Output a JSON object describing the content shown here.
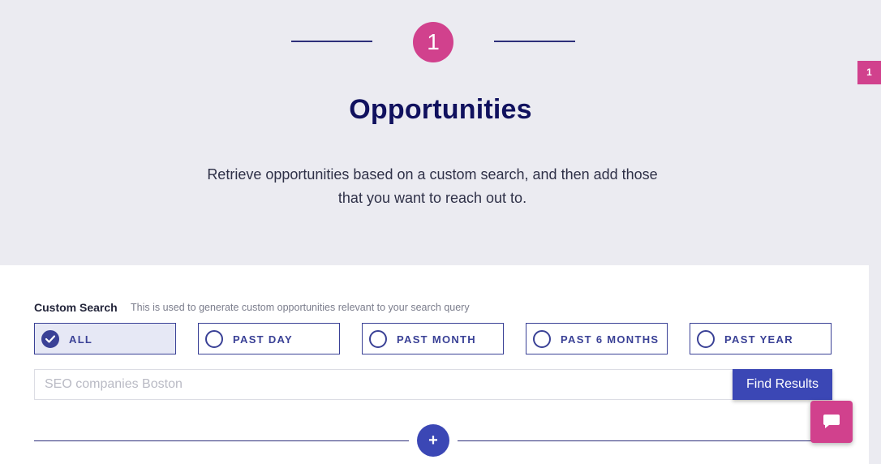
{
  "step": {
    "number": "1",
    "side_badge": "1",
    "title": "Opportunities",
    "subtitle": "Retrieve opportunities based on a custom search, and then add those that you want to reach out to."
  },
  "custom_search": {
    "label": "Custom Search",
    "help": "This is used to generate custom opportunities relevant to your search query",
    "options": [
      {
        "label": "ALL",
        "selected": true
      },
      {
        "label": "PAST DAY",
        "selected": false
      },
      {
        "label": "PAST MONTH",
        "selected": false
      },
      {
        "label": "PAST 6 MONTHS",
        "selected": false
      },
      {
        "label": "PAST YEAR",
        "selected": false
      }
    ],
    "input_value": "",
    "input_placeholder": "SEO companies Boston",
    "find_button": "Find Results"
  },
  "divider": {
    "plus_label": "+"
  },
  "icons": {
    "check": "check-icon",
    "chat": "chat-bubble-icon",
    "add": "plus-icon"
  },
  "colors": {
    "accent_pink": "#d1418d",
    "primary_blue": "#3b47b5",
    "title_navy": "#10115e",
    "hero_background": "#ebebf1"
  }
}
